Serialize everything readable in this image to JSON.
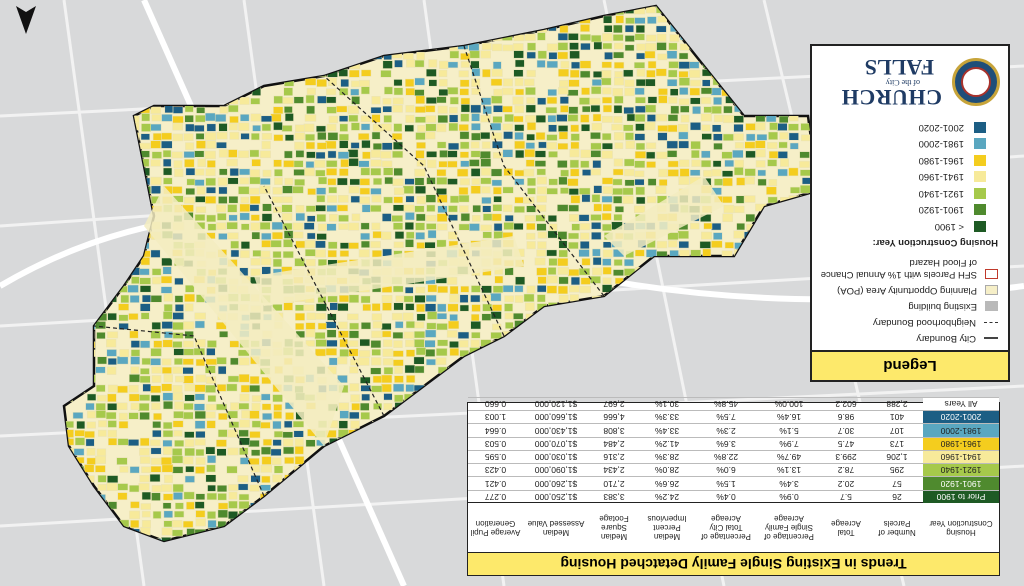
{
  "legend": {
    "title": "Legend",
    "items": [
      {
        "label": "City Boundary",
        "kind": "line-solid"
      },
      {
        "label": "Neighborhood Boundary",
        "kind": "line-dashed"
      },
      {
        "label": "Existing building",
        "kind": "box-gray"
      },
      {
        "label": "Planning Opportunity Area (POA)",
        "kind": "box-beige"
      },
      {
        "label": "SFH Parcels with 1% Annual Chance",
        "kind": "box-red"
      },
      {
        "label": "of Flood Hazard",
        "kind": "none"
      }
    ],
    "year_heading": "Housing Construction Year:",
    "years": [
      {
        "label": "< 1900",
        "color": "#1e5a24"
      },
      {
        "label": "1901-1920",
        "color": "#4f8a2e"
      },
      {
        "label": "1921-1940",
        "color": "#a6c94b"
      },
      {
        "label": "1941-1960",
        "color": "#f7ea9a"
      },
      {
        "label": "1961-1980",
        "color": "#f4cd1e"
      },
      {
        "label": "1981-2000",
        "color": "#5aa7c0"
      },
      {
        "label": "2001-2020",
        "color": "#1c5e84"
      }
    ]
  },
  "logo": {
    "top": "CHURCH",
    "of": "of the City",
    "bottom": "FALLS"
  },
  "table": {
    "title": "Trends in Existing Single Family Detatched Housing",
    "headers": [
      "Housing Construction Year",
      "Number of Parcels",
      "Total Acreage",
      "Percentage of Single Family Acreage",
      "Percentage of Total City Acreage",
      "Median Percent Impervious",
      "Median Square Footage",
      "Median Assessed Value",
      "Average Pupil Generation"
    ],
    "rows": [
      {
        "year": "Prior to 1900",
        "color": "#1e5a24",
        "text_color": "#ffffff",
        "cells": [
          "26",
          "5.7",
          "0.9%",
          "0.4%",
          "24.2%",
          "3,383",
          "$1,250,000",
          "0.277"
        ]
      },
      {
        "year": "1901-1920",
        "color": "#4f8a2e",
        "text_color": "#ffffff",
        "cells": [
          "57",
          "20.2",
          "3.4%",
          "1.5%",
          "26.6%",
          "2,710",
          "$1,260,000",
          "0.421"
        ]
      },
      {
        "year": "1921-1940",
        "color": "#a6c94b",
        "text_color": "#222222",
        "cells": [
          "295",
          "78.2",
          "13.1%",
          "6.0%",
          "28.0%",
          "2,434",
          "$1,090,000",
          "0.423"
        ]
      },
      {
        "year": "1941-1960",
        "color": "#f7ea9a",
        "text_color": "#222222",
        "cells": [
          "1,206",
          "299.3",
          "49.7%",
          "22.8%",
          "28.3%",
          "2,316",
          "$1,030,000",
          "0.595"
        ]
      },
      {
        "year": "1961-1980",
        "color": "#f4cd1e",
        "text_color": "#222222",
        "cells": [
          "173",
          "47.5",
          "7.9%",
          "3.6%",
          "41.2%",
          "2,484",
          "$1,070,000",
          "0.503"
        ]
      },
      {
        "year": "1981-2000",
        "color": "#5aa7c0",
        "text_color": "#222222",
        "cells": [
          "107",
          "30.7",
          "5.1%",
          "2.3%",
          "33.4%",
          "3,808",
          "$1,430,000",
          "0.664"
        ]
      },
      {
        "year": "2001-2020",
        "color": "#1c5e84",
        "text_color": "#ffffff",
        "cells": [
          "401",
          "98.6",
          "16.4%",
          "7.5%",
          "33.3%",
          "4,666",
          "$1,660,000",
          "1.003"
        ]
      },
      {
        "year": "All Years",
        "color": "#ffffff",
        "text_color": "#222222",
        "cells": [
          "2,288",
          "602.2",
          "100.0%",
          "45.8%",
          "30.1%",
          "2,697",
          "$1,120,000",
          "0.660"
        ]
      }
    ]
  }
}
